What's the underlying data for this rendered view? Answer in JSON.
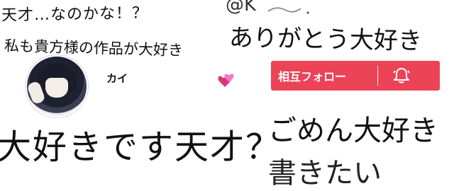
{
  "left": {
    "line1": "天才…なのかな！？",
    "line2": "私も貴方様の作品が大好き",
    "username": "カイ",
    "bottom_text": "大好きです天才？"
  },
  "right": {
    "handle": "@K",
    "line1": "ありがとう大好き",
    "follow_label": "相互フォロー",
    "line2": "ごめん大好き",
    "line3": "書きたい"
  },
  "colors": {
    "follow_button": "#ec4357",
    "heart": "#ec4fa8"
  },
  "icons": {
    "heart": "two-hearts-icon",
    "bell": "bell-icon",
    "avatar": "avatar"
  }
}
